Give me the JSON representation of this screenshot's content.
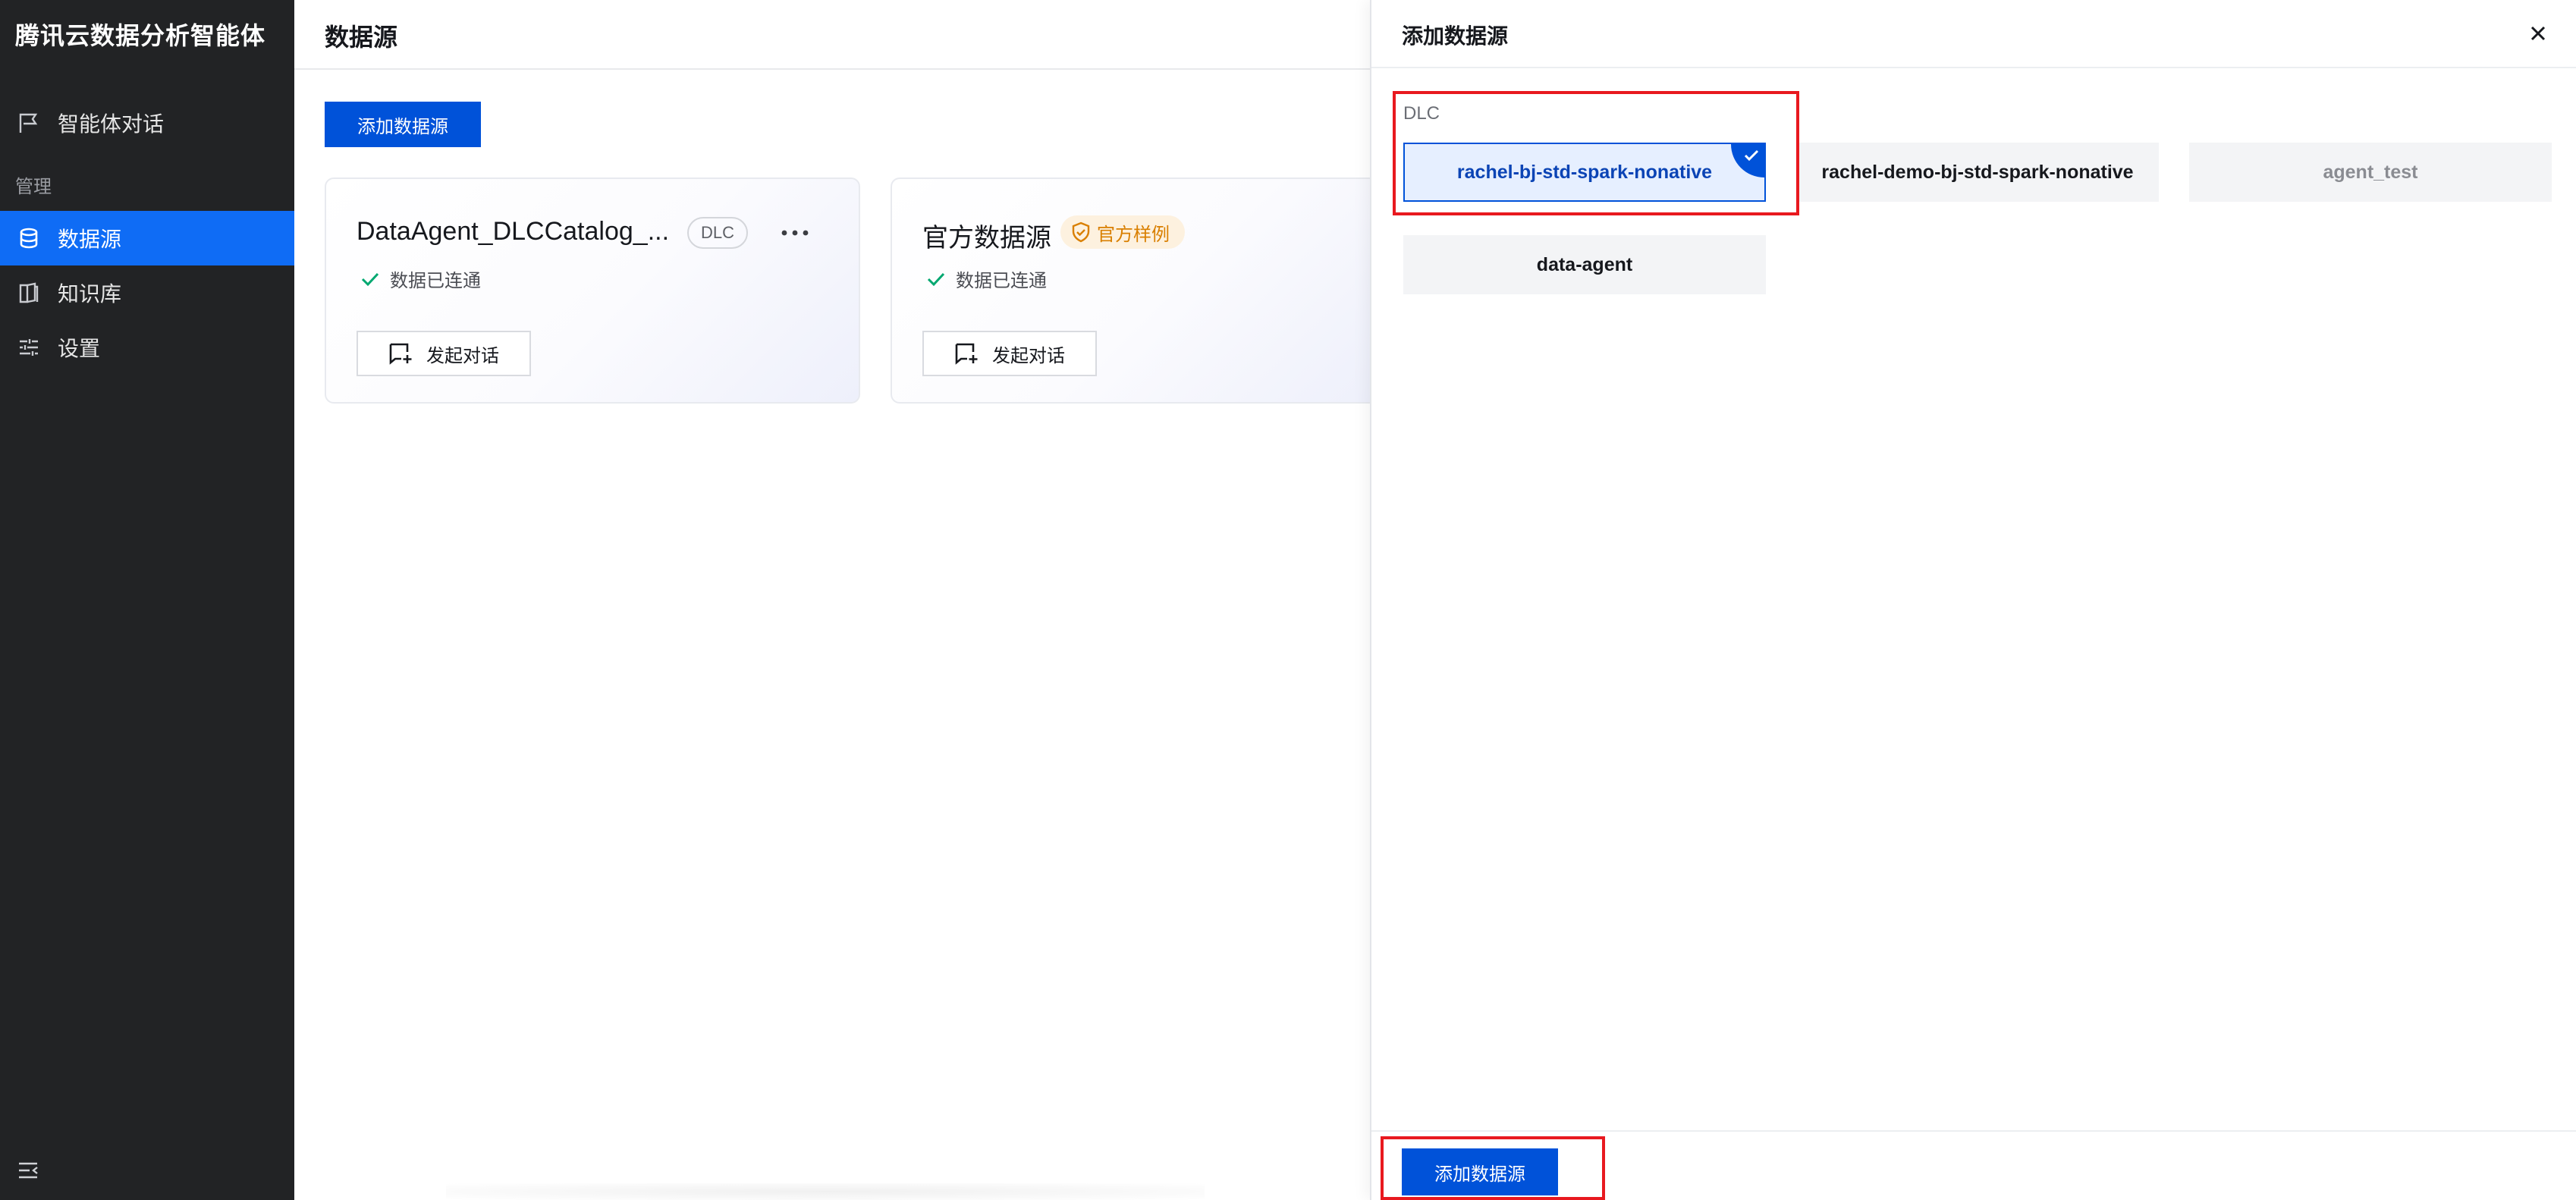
{
  "sidebar": {
    "brand": "腾讯云数据分析智能体",
    "items": [
      {
        "label": "智能体对话",
        "icon": "chat-flag-icon"
      },
      {
        "label": "数据源",
        "icon": "database-icon",
        "active": true
      },
      {
        "label": "知识库",
        "icon": "book-icon"
      },
      {
        "label": "设置",
        "icon": "sliders-icon"
      }
    ],
    "section_manage": "管理",
    "collapse_icon": "menu-collapse-icon"
  },
  "main": {
    "title": "数据源",
    "add_button": "添加数据源",
    "cards": [
      {
        "title": "DataAgent_DLCCatalog_...",
        "tag": "DLC",
        "status": "数据已连通",
        "action": "发起对话"
      },
      {
        "title": "官方数据源",
        "tag": "官方样例",
        "status": "数据已连通",
        "action": "发起对话"
      }
    ]
  },
  "drawer": {
    "title": "添加数据源",
    "group_label": "DLC",
    "options": [
      {
        "label": "rachel-bj-std-spark-nonative",
        "selected": true
      },
      {
        "label": "rachel-demo-bj-std-spark-nonative",
        "selected": false
      },
      {
        "label": "agent_test",
        "selected": false,
        "disabled": true
      },
      {
        "label": "data-agent",
        "selected": false
      }
    ],
    "submit_button": "添加数据源"
  },
  "colors": {
    "sidebar_bg": "#222325",
    "accent": "#0052d9",
    "active_nav": "#0f6cf5",
    "highlight_border": "#e8191f",
    "success": "#00a870",
    "official_tag": "#d97f00"
  }
}
